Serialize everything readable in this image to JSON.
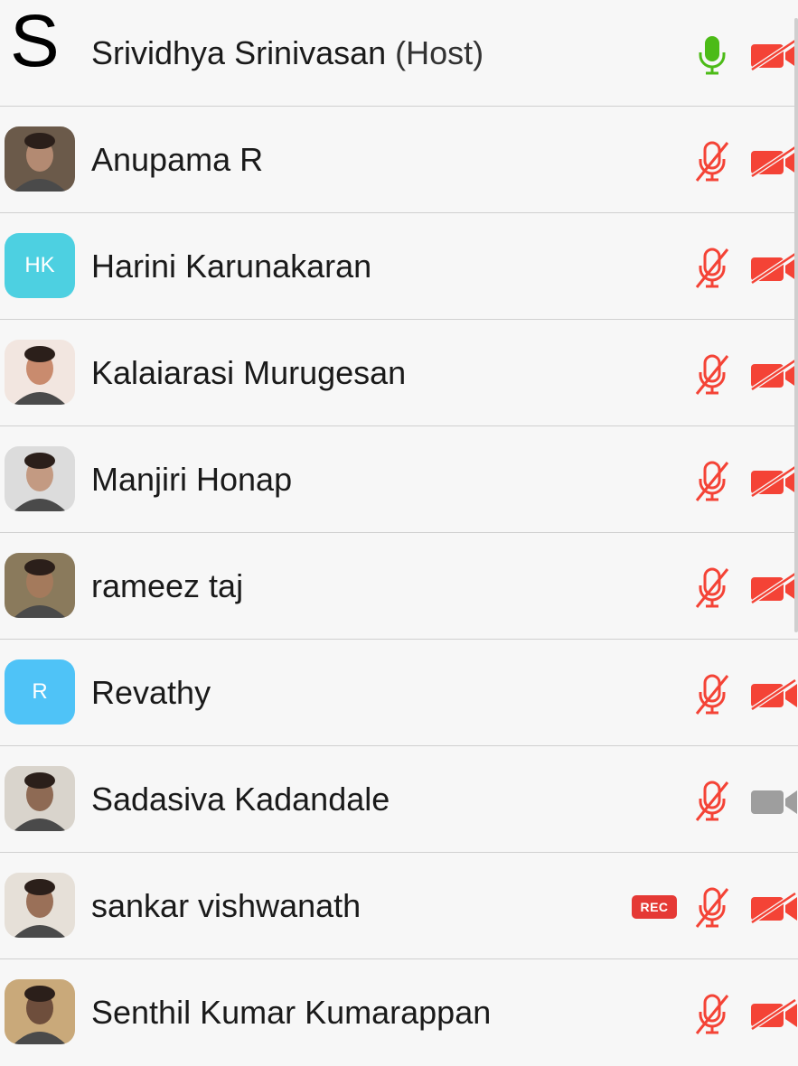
{
  "participants": [
    {
      "name": "Srividhya Srinivasan",
      "suffix": "(Host)",
      "avatar": {
        "type": "letter",
        "text": "S"
      },
      "mic": "on",
      "video": "off",
      "rec": false
    },
    {
      "name": "Anupama R",
      "suffix": "",
      "avatar": {
        "type": "photo",
        "bg": "#6b5a4a",
        "skin": "#b38a72"
      },
      "mic": "muted",
      "video": "off",
      "rec": false
    },
    {
      "name": "Harini Karunakaran",
      "suffix": "",
      "avatar": {
        "type": "initials",
        "text": "HK",
        "bg": "#4dd0e1"
      },
      "mic": "muted",
      "video": "off",
      "rec": false
    },
    {
      "name": "Kalaiarasi Murugesan",
      "suffix": "",
      "avatar": {
        "type": "photo",
        "bg": "#f2e6e0",
        "skin": "#c98b6e"
      },
      "mic": "muted",
      "video": "off",
      "rec": false
    },
    {
      "name": "Manjiri Honap",
      "suffix": "",
      "avatar": {
        "type": "photo",
        "bg": "#dcdcdc",
        "skin": "#c39a82"
      },
      "mic": "muted",
      "video": "off",
      "rec": false
    },
    {
      "name": "rameez taj",
      "suffix": "",
      "avatar": {
        "type": "photo",
        "bg": "#8a7a5c",
        "skin": "#a47a5c"
      },
      "mic": "muted",
      "video": "off",
      "rec": false
    },
    {
      "name": "Revathy",
      "suffix": "",
      "avatar": {
        "type": "initials",
        "text": "R",
        "bg": "#4fc3f7"
      },
      "mic": "muted",
      "video": "off",
      "rec": false
    },
    {
      "name": "Sadasiva Kadandale",
      "suffix": "",
      "avatar": {
        "type": "photo",
        "bg": "#d9d4cc",
        "skin": "#8e6a54"
      },
      "mic": "muted",
      "video": "disabled",
      "rec": false
    },
    {
      "name": "sankar vishwanath",
      "suffix": "",
      "avatar": {
        "type": "photo",
        "bg": "#e6e0d8",
        "skin": "#9a7058"
      },
      "mic": "muted",
      "video": "off",
      "rec": true,
      "rec_label": "REC"
    },
    {
      "name": "Senthil Kumar Kumarappan",
      "suffix": "",
      "avatar": {
        "type": "photo",
        "bg": "#c9a97a",
        "skin": "#6e4e3c"
      },
      "mic": "muted",
      "video": "off",
      "rec": false
    }
  ],
  "colors": {
    "muted_red": "#f44336",
    "mic_on_green": "#4cbb17",
    "video_disabled_gray": "#9e9e9e"
  },
  "icons": {
    "mic_on": "microphone-icon",
    "mic_muted": "microphone-muted-icon",
    "video_off": "video-off-icon",
    "video_disabled": "video-icon"
  }
}
